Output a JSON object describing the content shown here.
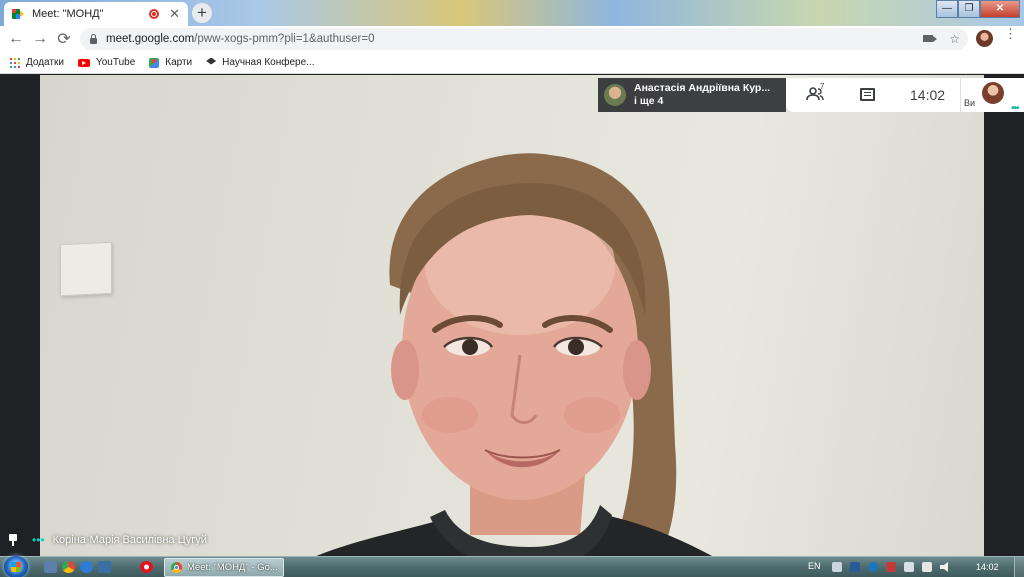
{
  "browser": {
    "tab_title": "Meet: \"МОНД\"",
    "tab_close": "✕",
    "new_tab": "+",
    "window_controls": {
      "minimize": "—",
      "restore": "❐",
      "close": "✕"
    },
    "url_host": "meet.google.com",
    "url_path": "/pww-xogs-pmm?pli=1&authuser=0",
    "nav": {
      "back": "←",
      "forward": "→",
      "reload": "⟳"
    },
    "omnibox_star": "☆",
    "menu": "⋮"
  },
  "bookmarks": [
    {
      "label": "Додатки",
      "icon": "apps-icon"
    },
    {
      "label": "YouTube",
      "icon": "youtube-icon"
    },
    {
      "label": "Карти",
      "icon": "maps-icon"
    },
    {
      "label": "Научная Конфере...",
      "icon": "graduation-cap-icon"
    }
  ],
  "meet": {
    "presenter_name": "Анастасія Андріївна Кур...",
    "presenter_more": "і ще 4",
    "participant_count": "7",
    "clock": "14:02",
    "you_label": "Ви",
    "speaking_dots": "•••",
    "speaker_name": "Коріна-Марія Василівна Цугуй",
    "accent_color": "#00b3a6"
  },
  "taskbar": {
    "active_task": "Meet: \"МОНД\" - Go...",
    "language": "EN",
    "time": "14:02"
  }
}
